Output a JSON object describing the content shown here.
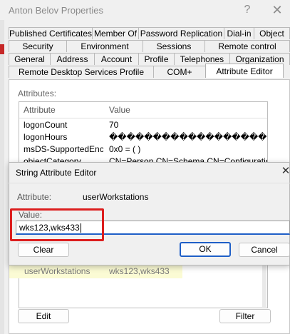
{
  "window": {
    "title": "Anton Belov Properties",
    "help_glyph": "?",
    "close_glyph": "✕"
  },
  "tabs": {
    "row1": [
      "Published Certificates",
      "Member Of",
      "Password Replication",
      "Dial-in",
      "Object"
    ],
    "row2": [
      "Security",
      "Environment",
      "Sessions",
      "Remote control"
    ],
    "row3": [
      "General",
      "Address",
      "Account",
      "Profile",
      "Telephones",
      "Organization"
    ],
    "row4": [
      "Remote Desktop Services Profile",
      "COM+",
      "Attribute Editor"
    ],
    "active": "Attribute Editor"
  },
  "attribute_editor": {
    "attributes_label": "Attributes:",
    "columns": [
      "Attribute",
      "Value"
    ],
    "rows": [
      {
        "attribute": "logonCount",
        "value": "70"
      },
      {
        "attribute": "logonHours",
        "value": "��������������������"
      },
      {
        "attribute": "msDS-SupportedEncr...",
        "value": "0x0 = ( )"
      },
      {
        "attribute": "objectCategory",
        "value": "CN=Person,CN=Schema,CN=Configuration,D"
      }
    ],
    "selected_row": {
      "attribute": "userWorkstations",
      "value": "wks123,wks433"
    },
    "edit_label": "Edit",
    "filter_label": "Filter"
  },
  "dialog": {
    "title": "String Attribute Editor",
    "close_glyph": "✕",
    "attribute_label": "Attribute:",
    "attribute_value": "userWorkstations",
    "value_label": "Value:",
    "value": "wks123,wks433",
    "clear_label": "Clear",
    "ok_label": "OK",
    "cancel_label": "Cancel"
  },
  "colors": {
    "highlight_box": "#dc1e1e",
    "focus_border": "#1f5fc7",
    "row_highlight": "#fbfbd4",
    "ok_border": "#1f5fc7"
  }
}
